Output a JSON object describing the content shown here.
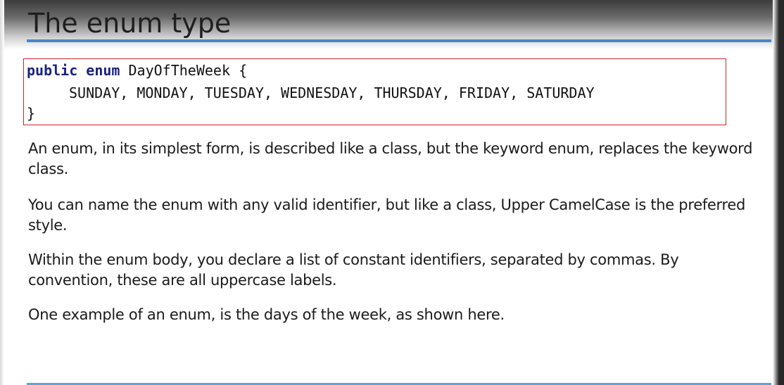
{
  "slide": {
    "title": "The enum type"
  },
  "code": {
    "line1_keyword1": "public",
    "line1_keyword2": "enum",
    "line1_name": "DayOfTheWeek",
    "line1_brace": "{",
    "line2": "SUNDAY, MONDAY, TUESDAY, WEDNESDAY, THURSDAY, FRIDAY, SATURDAY",
    "line3": "}"
  },
  "paragraphs": {
    "p1": "An enum, in its simplest form, is described like a class, but the keyword enum, replaces the keyword class.",
    "p2": "You can name the enum with any valid identifier, but like a class, Upper CamelCase is the preferred style.",
    "p3": "Within the enum body, you declare a list of constant identifiers, separated by commas.   By convention, these are all uppercase labels.",
    "p4": "One example of an enum, is the days of the week, as shown here."
  },
  "colors": {
    "title_rule": "#4a86c5",
    "code_border": "#c62828",
    "keyword": "#1a237e",
    "bottom_rule": "#5aa7d8"
  }
}
